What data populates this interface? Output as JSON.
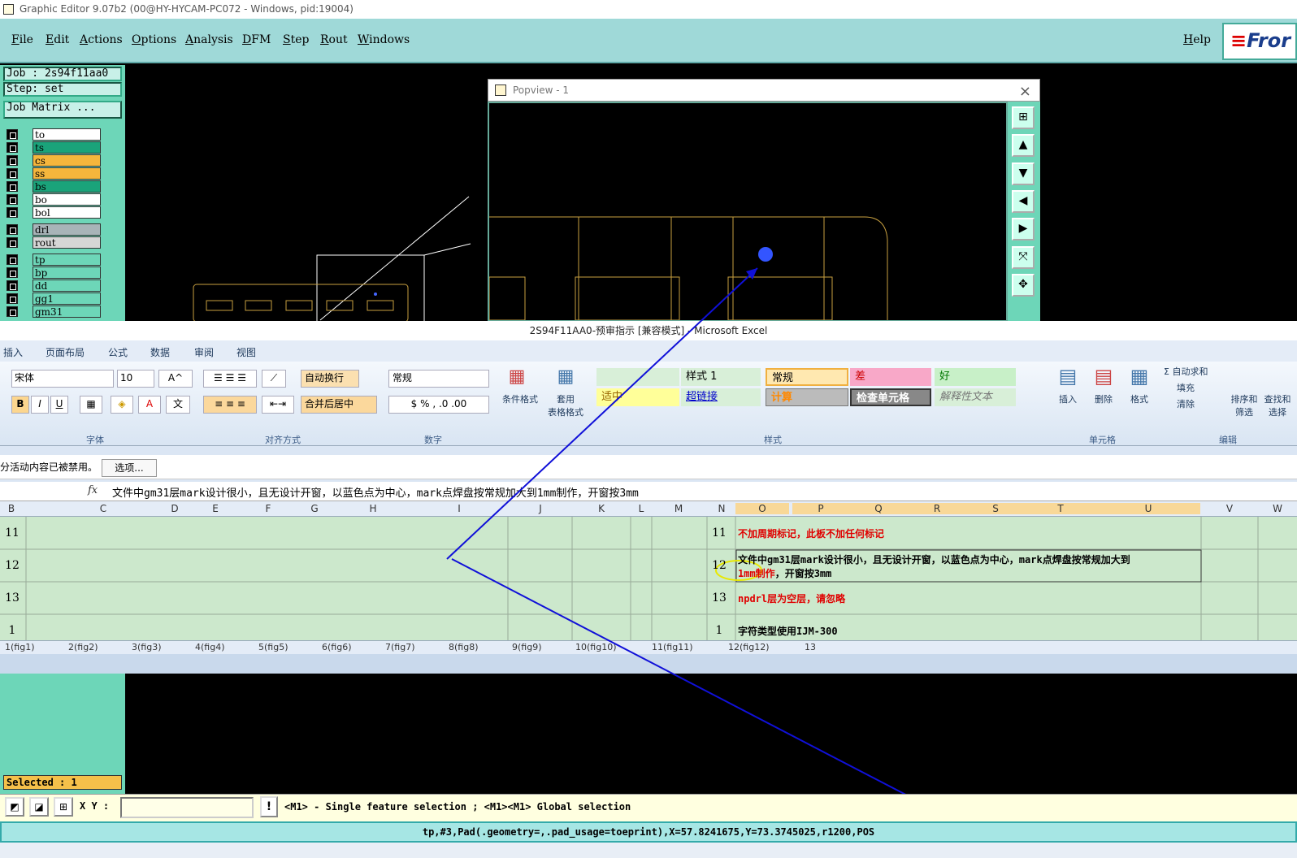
{
  "window": {
    "title": "Graphic Editor 9.07b2 (00@HY-HYCAM-PC072 - Windows, pid:19004)"
  },
  "menu": {
    "items": [
      "File",
      "Edit",
      "Actions",
      "Options",
      "Analysis",
      "DFM",
      "Step",
      "Rout",
      "Windows"
    ],
    "help": "Help",
    "logo": "Fror"
  },
  "job": {
    "job_label": "Job : 2s94f11aa0",
    "step_label": "Step: set",
    "matrix_button": "Job Matrix ..."
  },
  "layers": [
    {
      "name": "to",
      "color": "#ffffff"
    },
    {
      "name": "ts",
      "color": "#1aa37a"
    },
    {
      "name": "cs",
      "color": "#f5b63c"
    },
    {
      "name": "ss",
      "color": "#f5b63c"
    },
    {
      "name": "bs",
      "color": "#1aa37a"
    },
    {
      "name": "bo",
      "color": "#ffffff"
    },
    {
      "name": "bol",
      "color": "#ffffff"
    },
    {
      "name": "drl",
      "color": "#a8b4b8"
    },
    {
      "name": "rout",
      "color": "#d6d6d6"
    },
    {
      "name": "tp",
      "color": "#6dd6b8"
    },
    {
      "name": "bp",
      "color": "#6dd6b8"
    },
    {
      "name": "dd",
      "color": "#6dd6b8"
    },
    {
      "name": "gg1",
      "color": "#6dd6b8"
    },
    {
      "name": "gm31",
      "color": "#6dd6b8"
    }
  ],
  "popview": {
    "title": "Popview - 1",
    "close": "×"
  },
  "excel": {
    "title": "2S94F11AA0-预审指示  [兼容模式] - Microsoft Excel",
    "tabs": [
      "插入",
      "页面布局",
      "公式",
      "数据",
      "审阅",
      "视图"
    ],
    "font_name": "宋体",
    "font_size": "10",
    "wrap_text": "自动换行",
    "merge_center": "合并后居中",
    "number_format": "常规",
    "cond_format": "条件格式",
    "table_format_1": "套用",
    "table_format_2": "表格格式",
    "styles": {
      "s1": "样式 1",
      "normal": "常规",
      "bad": "差",
      "good": "好",
      "neutral": "适中",
      "hyperlink": "超链接",
      "calc": "计算",
      "check": "检查单元格",
      "explain": "解释性文本"
    },
    "cells_btns": {
      "insert": "插入",
      "delete": "删除",
      "format": "格式"
    },
    "edit_btns": {
      "autosum": "Σ 自动求和",
      "fill": "填充",
      "clear": "清除",
      "sort": "排序和",
      "sort2": "筛选",
      "find": "查找和",
      "find2": "选择"
    },
    "group_labels": {
      "font": "字体",
      "align": "对齐方式",
      "number": "数字",
      "styles": "样式",
      "cells": "单元格",
      "edit": "编辑"
    },
    "notice": "分活动内容已被禁用。",
    "notice_button": "选项...",
    "formula_fx": "fx",
    "formula": "文件中gm31层mark设计很小，且无设计开窗，以蓝色点为中心，mark点焊盘按常规加大到1mm制作，开窗按3mm",
    "columns": [
      "B",
      "C",
      "D",
      "E",
      "F",
      "G",
      "H",
      "I",
      "J",
      "K",
      "L",
      "M",
      "N",
      "O",
      "P",
      "Q",
      "R",
      "S",
      "T",
      "U",
      "V",
      "W"
    ],
    "rows": [
      {
        "num": "11",
        "text": "不加周期标记，此板不加任何标记",
        "color": "#e00000"
      },
      {
        "num": "12",
        "text": "文件中gm31层mark设计很小，且无设计开窗，以蓝色点为中心，mark点焊盘按常规加大到",
        "text2": "1mm制作",
        "text3": "，开窗按3mm",
        "color": "#000000"
      },
      {
        "num": "13",
        "text": "npdrl层为空层，请忽略",
        "color": "#e00000"
      },
      {
        "num": "1",
        "text": "字符类型使用IJM-300",
        "color": "#000000"
      }
    ],
    "sheets": [
      "1(fig1)",
      "2(fig2)",
      "3(fig3)",
      "4(fig4)",
      "5(fig5)",
      "6(fig6)",
      "7(fig7)",
      "8(fig8)",
      "9(fig9)",
      "10(fig10)",
      "11(fig11)",
      "12(fig12)",
      "13"
    ]
  },
  "selected": "Selected : 1",
  "cmd": {
    "xy_label": "X Y :",
    "xy_value": "",
    "warn": "!",
    "hint": "<M1> - Single feature selection ; <M1><M1> Global selection"
  },
  "status": "tp,#3,Pad(.geometry=,.pad_usage=toeprint),X=57.8241675,Y=73.3745025,r1200,POS"
}
